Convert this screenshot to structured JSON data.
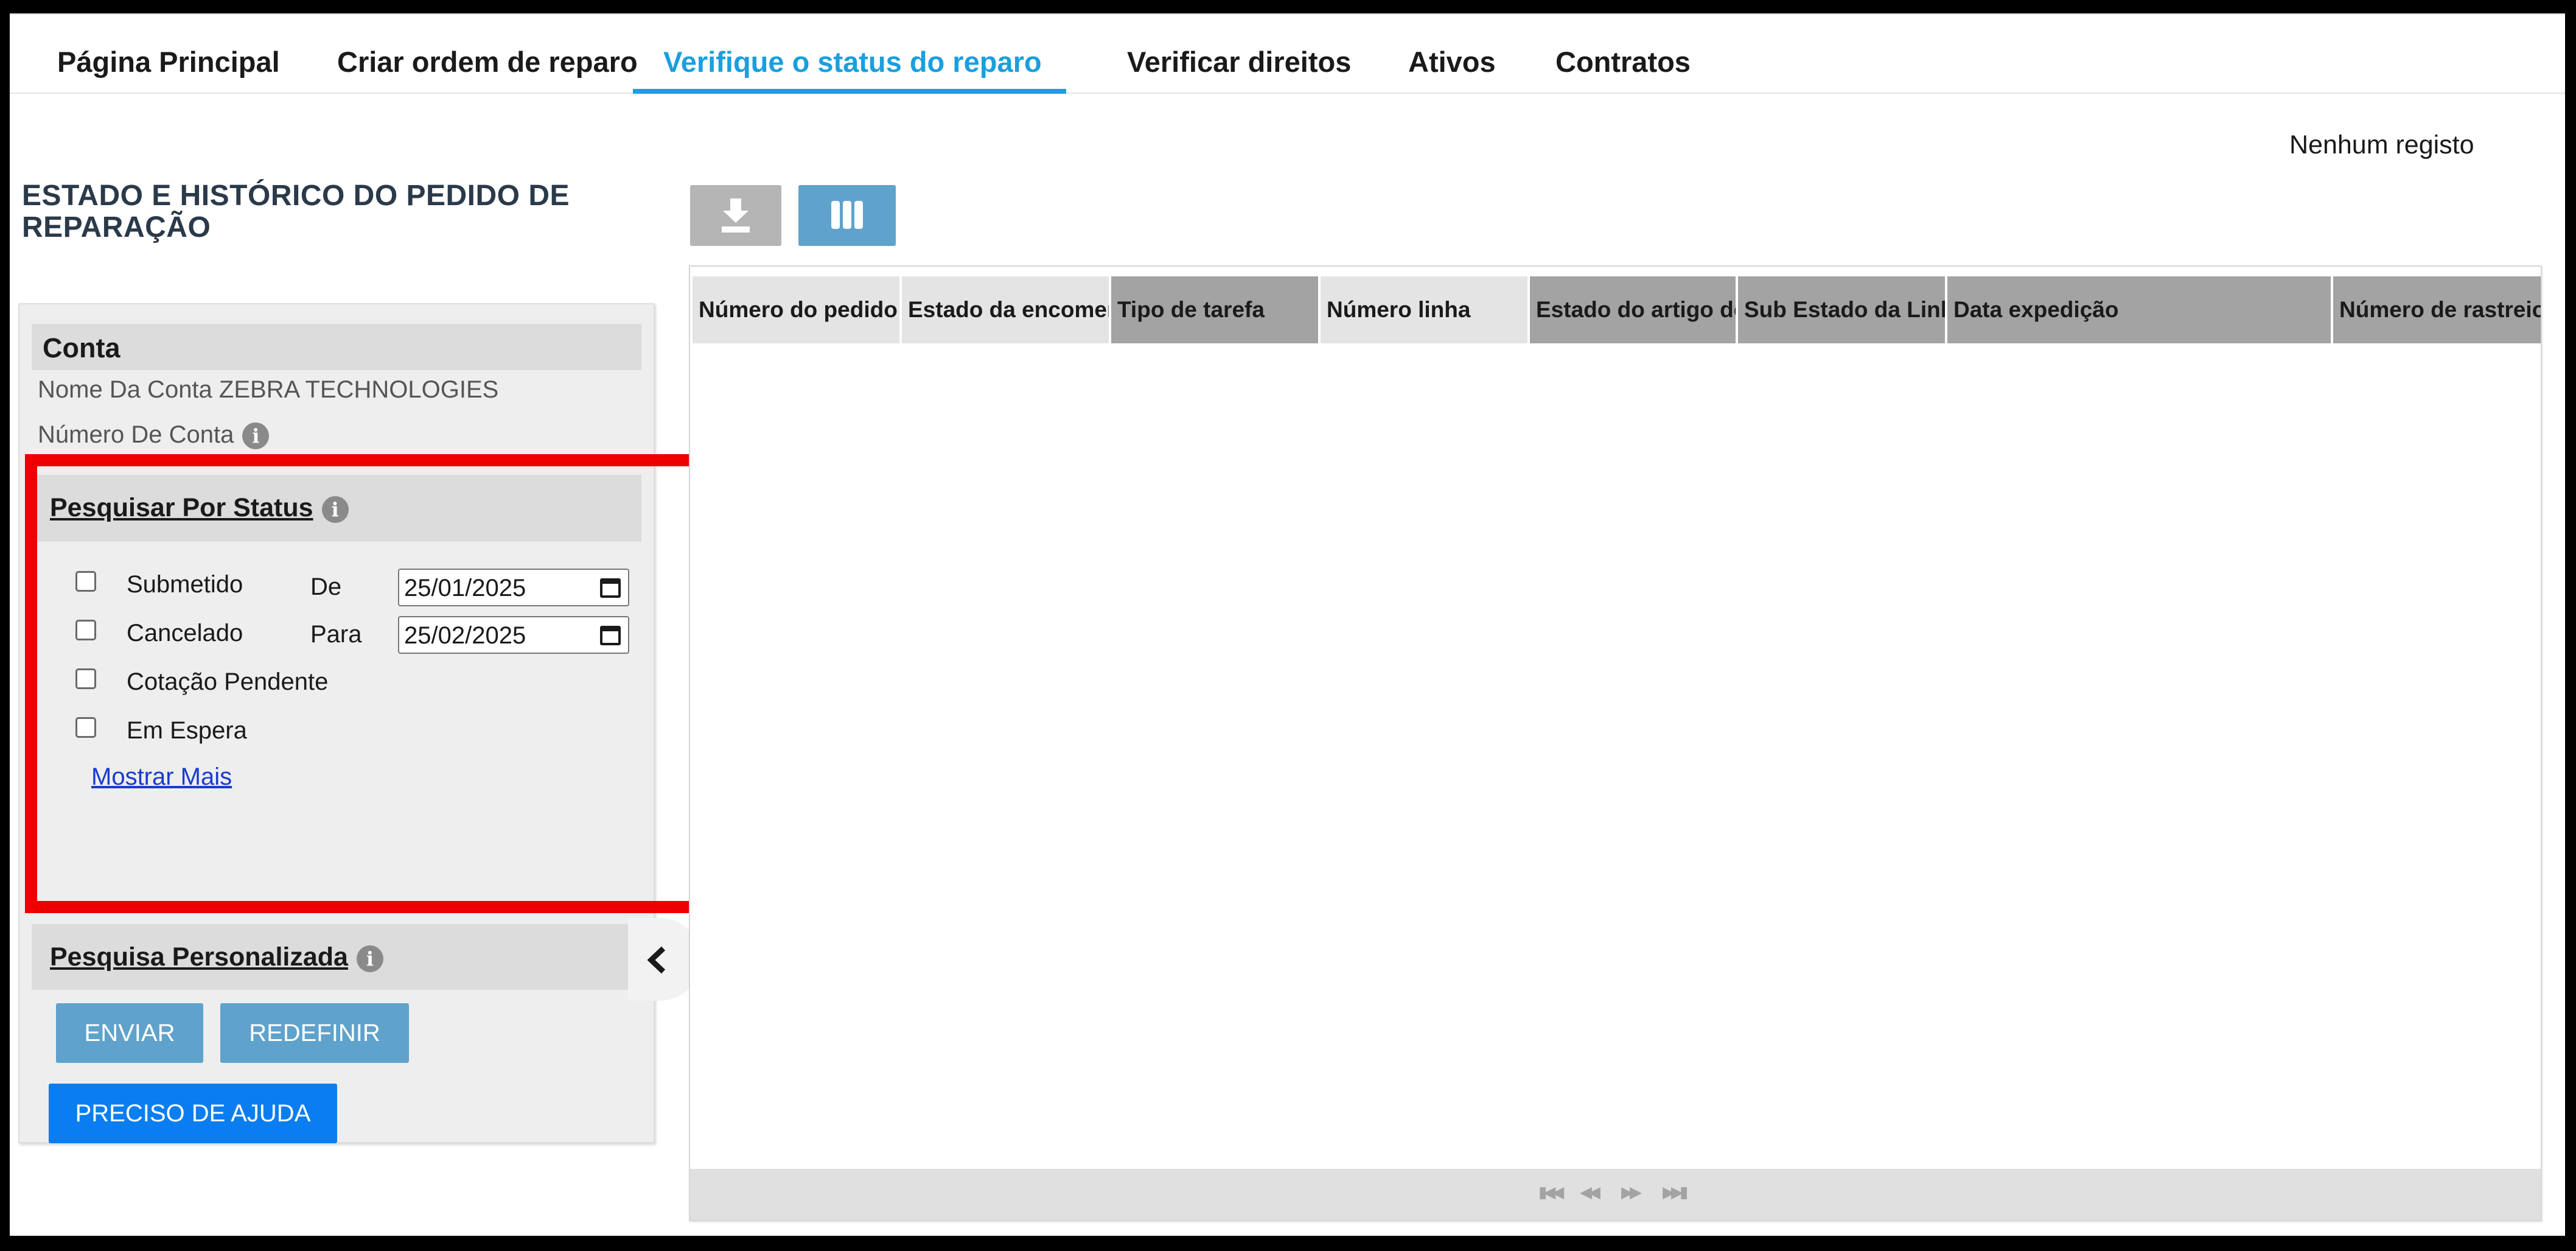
{
  "nav": {
    "tabs": [
      {
        "label": "Página Principal"
      },
      {
        "label": "Criar ordem de reparo"
      },
      {
        "label": "Verifique o status do reparo",
        "active": true
      },
      {
        "label": "Verificar direitos"
      },
      {
        "label": "Ativos"
      },
      {
        "label": "Contratos"
      }
    ]
  },
  "page": {
    "title": "ESTADO E HISTÓRICO DO PEDIDO DE REPARAÇÃO"
  },
  "account": {
    "header": "Conta",
    "name_label": "Nome Da Conta",
    "name_value": "ZEBRA TECHNOLOGIES",
    "number_label": "Número De Conta"
  },
  "status_search": {
    "title": "Pesquisar Por Status",
    "options": [
      {
        "label": "Submetido",
        "checked": false
      },
      {
        "label": "Cancelado",
        "checked": false
      },
      {
        "label": "Cotação Pendente",
        "checked": false
      },
      {
        "label": "Em Espera",
        "checked": false
      }
    ],
    "from_label": "De",
    "from_value": "25/01/2025",
    "to_label": "Para",
    "to_value": "25/02/2025",
    "show_more": "Mostrar Mais"
  },
  "custom_search": {
    "title": "Pesquisa Personalizada"
  },
  "buttons": {
    "submit": "ENVIAR",
    "reset": "REDEFINIR",
    "help": "PRECISO DE AJUDA"
  },
  "grid": {
    "record_count": "Nenhum registo",
    "columns": [
      "Número do pedido",
      "Estado da encomenda",
      "Tipo de tarefa",
      "Número linha",
      "Estado do artigo de",
      "Sub Estado da Linha",
      "Data expedição",
      "Número de rastreio"
    ],
    "sort_indicator": "↓"
  },
  "icons": {
    "info": "info-icon",
    "download": "download-icon",
    "columns": "columns-icon",
    "collapse": "chevron-left-icon",
    "pager": [
      "first-page-icon",
      "prev-page-icon",
      "next-page-icon",
      "last-page-icon"
    ]
  },
  "colors": {
    "accent": "#1a9fdf",
    "button": "#5fa2cc",
    "help_button": "#0a7ef0",
    "highlight": "#ee0000"
  }
}
